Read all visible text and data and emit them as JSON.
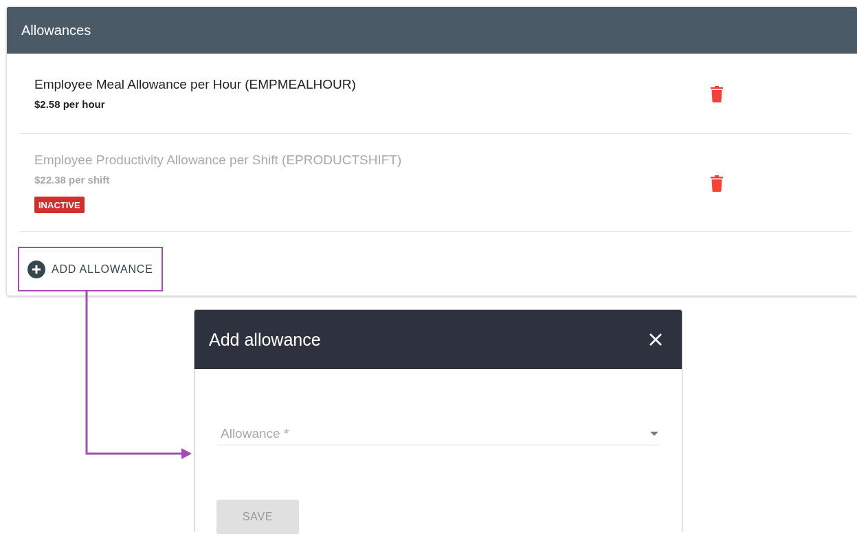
{
  "panel": {
    "title": "Allowances",
    "items": [
      {
        "name": "Employee Meal Allowance per Hour (EMPMEALHOUR)",
        "rate": "$2.58 per hour",
        "active": true
      },
      {
        "name": "Employee Productivity Allowance per Shift (EPRODUCTSHIFT)",
        "rate": "$22.38 per shift",
        "active": false,
        "badge": "INACTIVE"
      }
    ],
    "add_button": {
      "label": "ADD ALLOWANCE",
      "highlighted": true
    }
  },
  "dialog": {
    "title": "Add allowance",
    "field": {
      "placeholder": "Allowance *"
    },
    "save_button": {
      "label": "SAVE",
      "disabled": true
    }
  }
}
